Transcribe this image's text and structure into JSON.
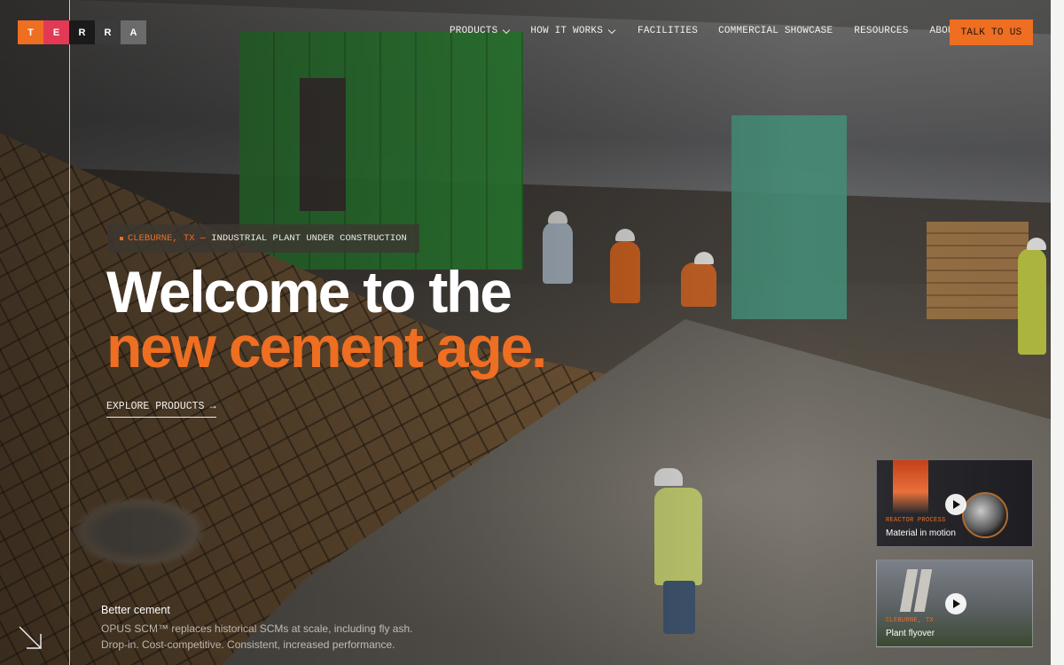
{
  "logo": {
    "letters": [
      "T",
      "E",
      "R",
      "R",
      "A"
    ],
    "colors": [
      "#ee6e22",
      "#e23a55",
      "#1a1a1a",
      "#3a3a3a",
      "#6b6b6b"
    ]
  },
  "nav": {
    "items": [
      {
        "label": "PRODUCTS",
        "has_dropdown": true
      },
      {
        "label": "HOW IT WORKS",
        "has_dropdown": true
      },
      {
        "label": "FACILITIES",
        "has_dropdown": false
      },
      {
        "label": "COMMERCIAL SHOWCASE",
        "has_dropdown": false
      },
      {
        "label": "RESOURCES",
        "has_dropdown": false
      },
      {
        "label": "ABOUT",
        "has_dropdown": false
      }
    ],
    "cta_label": "TALK TO US"
  },
  "hero": {
    "tag_location": "CLEBURNE, TX —",
    "tag_description": "INDUSTRIAL PLANT UNDER CONSTRUCTION",
    "headline_line1": "Welcome to the",
    "headline_line2": "new cement age.",
    "explore_label": "EXPLORE PRODUCTS",
    "explore_arrow": "→"
  },
  "feature": {
    "title": "Better cement",
    "line1": "OPUS SCM™ replaces historical SCMs at scale, including fly ash.",
    "line2": "Drop-in. Cost-competitive. Consistent, increased performance."
  },
  "cards": [
    {
      "kicker": "REACTOR PROCESS",
      "title": "Material in motion"
    },
    {
      "kicker": "CLEBURNE, TX",
      "title": "Plant flyover"
    }
  ],
  "colors": {
    "accent": "#ee6e22",
    "logo_pink": "#e23a55"
  },
  "icons": {
    "dropdown": "chevron-down-icon",
    "explore": "arrow-right-icon",
    "corner": "arrow-down-right-icon",
    "video": "play-icon"
  }
}
